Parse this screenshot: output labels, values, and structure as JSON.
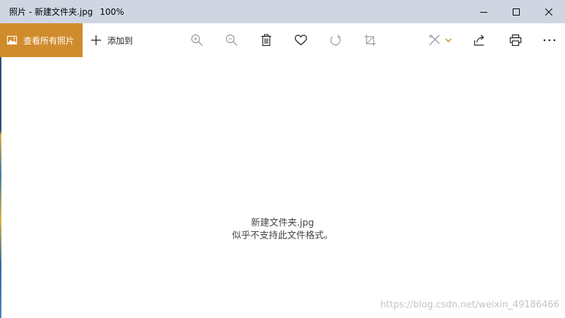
{
  "window": {
    "app_name": "照片",
    "separator": " - ",
    "file_name": "新建文件夹.jpg",
    "zoom": "100%"
  },
  "toolbar": {
    "view_all_label": "查看所有照片",
    "add_to_label": "添加到",
    "tools": [
      "zoom-in-icon",
      "zoom-out-icon",
      "delete-icon",
      "heart-icon",
      "rotate-icon",
      "crop-icon",
      "edit-icon",
      "share-icon",
      "print-icon",
      "more-icon"
    ]
  },
  "message": {
    "file_name": "新建文件夹.jpg",
    "error": "似乎不支持此文件格式。"
  },
  "watermark": "https://blog.csdn.net/weixin_49186466",
  "colors": {
    "titlebar": "#cfd6e2",
    "accent": "#d08c2c",
    "background": "#ffffff"
  }
}
